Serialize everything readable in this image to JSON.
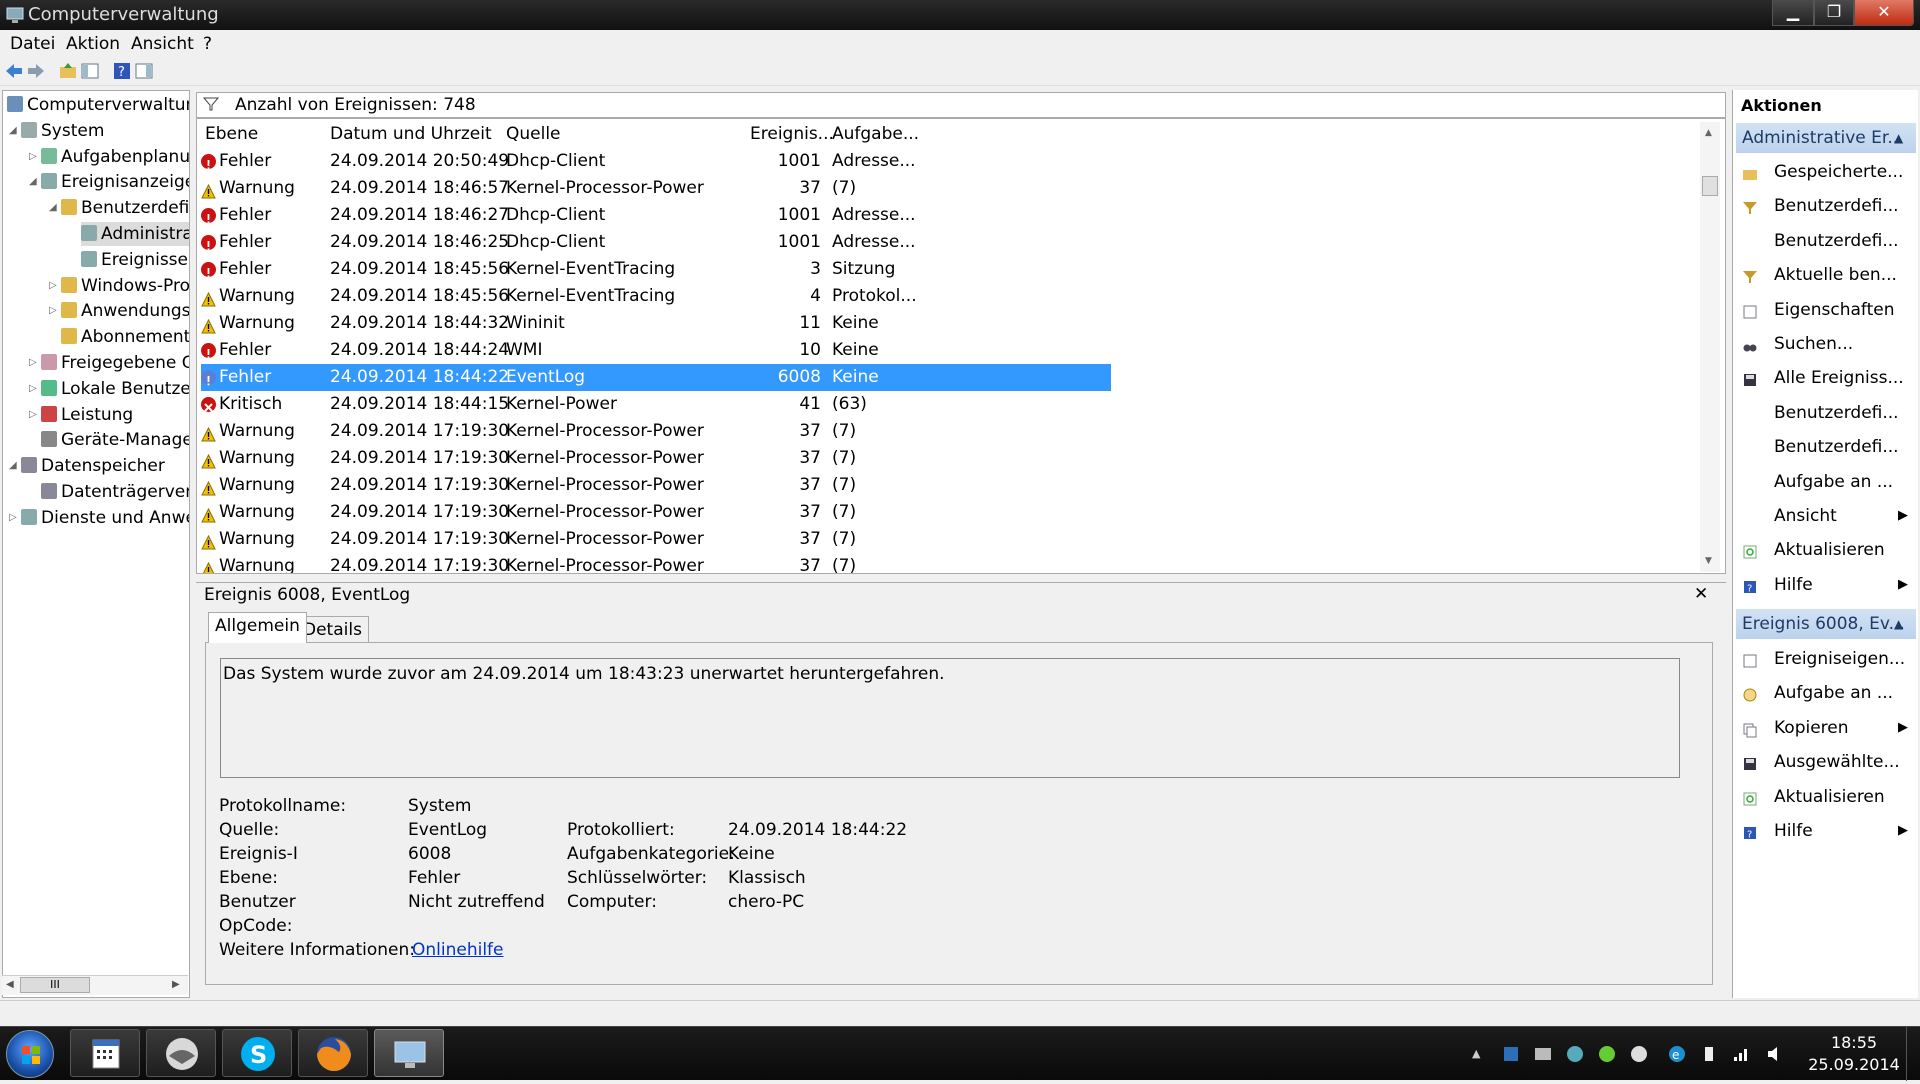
{
  "window": {
    "title": "Computerverwaltung"
  },
  "menu": [
    "Datei",
    "Aktion",
    "Ansicht",
    "?"
  ],
  "tree": [
    {
      "label": "Computerverwaltung",
      "indent": 0,
      "exp": ""
    },
    {
      "label": "System",
      "indent": 1,
      "exp": "◢"
    },
    {
      "label": "Aufgabenplanur",
      "indent": 2,
      "exp": "▷"
    },
    {
      "label": "Ereignisanzeige",
      "indent": 2,
      "exp": "◢"
    },
    {
      "label": "Benutzerdefin",
      "indent": 3,
      "exp": "◢"
    },
    {
      "label": "Administrat",
      "indent": 4,
      "exp": ""
    },
    {
      "label": "Ereignisse c",
      "indent": 4,
      "exp": ""
    },
    {
      "label": "Windows-Prot",
      "indent": 3,
      "exp": "▷"
    },
    {
      "label": "Anwendungs-",
      "indent": 3,
      "exp": "▷"
    },
    {
      "label": "Abonnements",
      "indent": 3,
      "exp": ""
    },
    {
      "label": "Freigegebene Or",
      "indent": 2,
      "exp": "▷"
    },
    {
      "label": "Lokale Benutzer",
      "indent": 2,
      "exp": "▷"
    },
    {
      "label": "Leistung",
      "indent": 2,
      "exp": "▷"
    },
    {
      "label": "Geräte-Manager",
      "indent": 2,
      "exp": ""
    },
    {
      "label": "Datenspeicher",
      "indent": 1,
      "exp": "◢"
    },
    {
      "label": "Datenträgerverw",
      "indent": 2,
      "exp": ""
    },
    {
      "label": "Dienste und Anwer",
      "indent": 1,
      "exp": "▷"
    }
  ],
  "tree_scroll": "III",
  "filter": {
    "label": "Anzahl von Ereignissen: 748"
  },
  "grid": {
    "headers": [
      "Ebene",
      "Datum und Uhrzeit",
      "Quelle",
      "Ereignis...",
      "Aufgabe..."
    ],
    "rows": [
      {
        "level": "Fehler",
        "date": "24.09.2014 20:50:49",
        "source": "Dhcp-Client",
        "id": "1001",
        "task": "Adresse..."
      },
      {
        "level": "Warnung",
        "date": "24.09.2014 18:46:57",
        "source": "Kernel-Processor-Power",
        "id": "37",
        "task": "(7)"
      },
      {
        "level": "Fehler",
        "date": "24.09.2014 18:46:27",
        "source": "Dhcp-Client",
        "id": "1001",
        "task": "Adresse..."
      },
      {
        "level": "Fehler",
        "date": "24.09.2014 18:46:25",
        "source": "Dhcp-Client",
        "id": "1001",
        "task": "Adresse..."
      },
      {
        "level": "Fehler",
        "date": "24.09.2014 18:45:56",
        "source": "Kernel-EventTracing",
        "id": "3",
        "task": "Sitzung"
      },
      {
        "level": "Warnung",
        "date": "24.09.2014 18:45:56",
        "source": "Kernel-EventTracing",
        "id": "4",
        "task": "Protokol..."
      },
      {
        "level": "Warnung",
        "date": "24.09.2014 18:44:32",
        "source": "Wininit",
        "id": "11",
        "task": "Keine"
      },
      {
        "level": "Fehler",
        "date": "24.09.2014 18:44:24",
        "source": "WMI",
        "id": "10",
        "task": "Keine"
      },
      {
        "level": "Fehler",
        "date": "24.09.2014 18:44:22",
        "source": "EventLog",
        "id": "6008",
        "task": "Keine"
      },
      {
        "level": "Kritisch",
        "date": "24.09.2014 18:44:15",
        "source": "Kernel-Power",
        "id": "41",
        "task": "(63)"
      },
      {
        "level": "Warnung",
        "date": "24.09.2014 17:19:30",
        "source": "Kernel-Processor-Power",
        "id": "37",
        "task": "(7)"
      },
      {
        "level": "Warnung",
        "date": "24.09.2014 17:19:30",
        "source": "Kernel-Processor-Power",
        "id": "37",
        "task": "(7)"
      },
      {
        "level": "Warnung",
        "date": "24.09.2014 17:19:30",
        "source": "Kernel-Processor-Power",
        "id": "37",
        "task": "(7)"
      },
      {
        "level": "Warnung",
        "date": "24.09.2014 17:19:30",
        "source": "Kernel-Processor-Power",
        "id": "37",
        "task": "(7)"
      },
      {
        "level": "Warnung",
        "date": "24.09.2014 17:19:30",
        "source": "Kernel-Processor-Power",
        "id": "37",
        "task": "(7)"
      },
      {
        "level": "Warnung",
        "date": "24.09.2014 17:19:30",
        "source": "Kernel-Processor-Power",
        "id": "37",
        "task": "(7)"
      }
    ],
    "selected_index": 8
  },
  "detail": {
    "title": "Ereignis 6008, EventLog",
    "close": "✕",
    "tabs": [
      "Allgemein",
      "Details"
    ],
    "description": "Das System wurde zuvor am 24.09.2014 um 18:43:23 unerwartet heruntergefahren.",
    "fields": {
      "protokollname_label": "Protokollname:",
      "protokollname": "System",
      "quelle_label": "Quelle:",
      "quelle": "EventLog",
      "protokolliert_label": "Protokolliert:",
      "protokolliert": "24.09.2014 18:44:22",
      "ereignis_label": "Ereignis-I",
      "ereignis": "6008",
      "aufgabenkategorie_label": "Aufgabenkategorie:",
      "aufgabenkategorie": "Keine",
      "ebene_label": "Ebene:",
      "ebene": "Fehler",
      "schluessel_label": "Schlüsselwörter:",
      "schluessel": "Klassisch",
      "benutzer_label": "Benutzer",
      "benutzer": "Nicht zutreffend",
      "computer_label": "Computer:",
      "computer": "chero-PC",
      "opcode_label": "OpCode:",
      "weitere_label": "Weitere Informationen:",
      "weitere_link": "Onlinehilfe"
    }
  },
  "actions": {
    "title": "Aktionen",
    "section1": "Administrative Er...",
    "items1": [
      {
        "label": "Gespeicherte...",
        "icon": "folder-open-icon",
        "arrow": false
      },
      {
        "label": "Benutzerdefi...",
        "icon": "filter-icon",
        "arrow": false
      },
      {
        "label": "Benutzerdefi...",
        "icon": "",
        "arrow": false
      },
      {
        "label": "Aktuelle ben...",
        "icon": "filter-icon",
        "arrow": false
      },
      {
        "label": "Eigenschaften",
        "icon": "properties-icon",
        "arrow": false
      },
      {
        "label": "Suchen...",
        "icon": "binoculars-icon",
        "arrow": false
      },
      {
        "label": "Alle Ereigniss...",
        "icon": "save-icon",
        "arrow": false
      },
      {
        "label": "Benutzerdefi...",
        "icon": "",
        "arrow": false
      },
      {
        "label": "Benutzerdefi...",
        "icon": "",
        "arrow": false
      },
      {
        "label": "Aufgabe an ...",
        "icon": "",
        "arrow": false
      },
      {
        "label": "Ansicht",
        "icon": "",
        "arrow": true
      },
      {
        "label": "Aktualisieren",
        "icon": "refresh-icon",
        "arrow": false
      },
      {
        "label": "Hilfe",
        "icon": "help-icon",
        "arrow": true
      }
    ],
    "section2": "Ereignis 6008, Ev...",
    "items2": [
      {
        "label": "Ereigniseigen...",
        "icon": "properties-icon",
        "arrow": false
      },
      {
        "label": "Aufgabe an ...",
        "icon": "task-icon",
        "arrow": false
      },
      {
        "label": "Kopieren",
        "icon": "copy-icon",
        "arrow": true
      },
      {
        "label": "Ausgewählte...",
        "icon": "save-icon",
        "arrow": false
      },
      {
        "label": "Aktualisieren",
        "icon": "refresh-icon",
        "arrow": false
      },
      {
        "label": "Hilfe",
        "icon": "help-icon",
        "arrow": true
      }
    ]
  },
  "clock": {
    "time": "18:55",
    "date": "25.09.2014"
  },
  "colors": {
    "selection": "#3399ff",
    "error": "#cc1111",
    "warning": "#f2c200",
    "critical": "#cc1111",
    "action_header": "#c4d8f0",
    "link": "#0033cc"
  }
}
